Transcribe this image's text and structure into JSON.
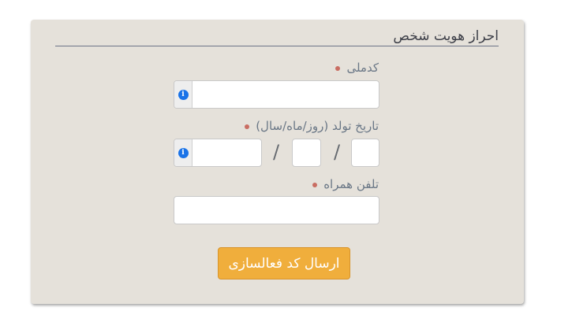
{
  "form": {
    "title": "احراز هویت شخص",
    "national_code": {
      "label": "کدملی",
      "value": "",
      "icon": "info-icon"
    },
    "birth_date": {
      "label": "تاریخ تولد (روز/ماه/سال)",
      "separator": "/",
      "day": "",
      "month": "",
      "year": "",
      "icon": "info-icon"
    },
    "mobile": {
      "label": "تلفن همراه",
      "value": ""
    },
    "submit_label": "ارسال کد فعالسازی"
  },
  "colors": {
    "panel_bg": "#e5e1da",
    "required_dot": "#c96d62",
    "label_text": "#6a7786",
    "info_icon": "#1a73e8",
    "submit_bg": "#f0ae3c"
  }
}
